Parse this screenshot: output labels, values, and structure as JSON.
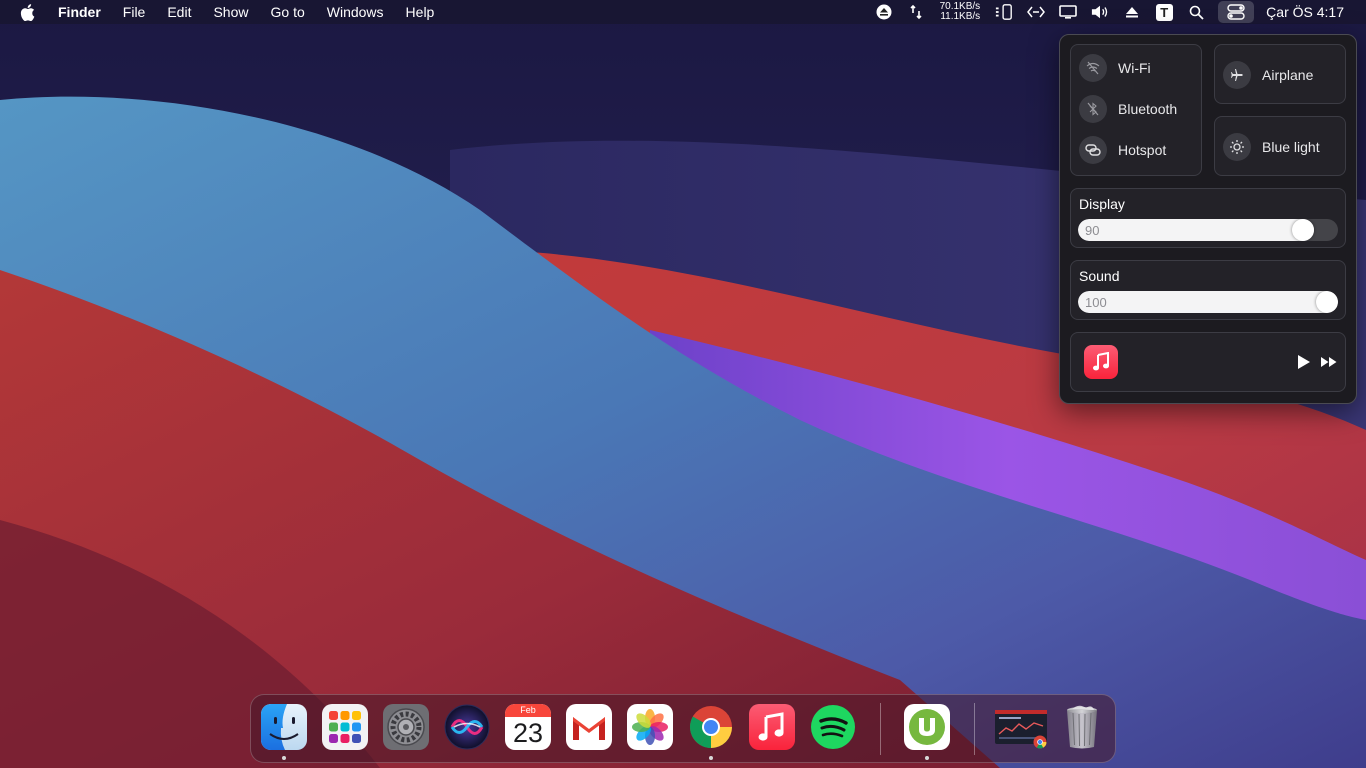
{
  "menubar": {
    "app_name": "Finder",
    "menus": [
      "File",
      "Edit",
      "Show",
      "Go to",
      "Windows",
      "Help"
    ],
    "net_up": "70.1KB/s",
    "net_down": "11.1KB/s",
    "clock": "Çar ÖS 4:17",
    "t_badge": "T"
  },
  "control_center": {
    "connectivity": [
      {
        "label": "Wi-Fi",
        "icon": "wifi-off-icon"
      },
      {
        "label": "Bluetooth",
        "icon": "bluetooth-off-icon"
      },
      {
        "label": "Hotspot",
        "icon": "hotspot-icon"
      }
    ],
    "airplane": {
      "label": "Airplane",
      "icon": "airplane-icon"
    },
    "blue_light": {
      "label": "Blue light",
      "icon": "sun-icon"
    },
    "display": {
      "title": "Display",
      "value": "90",
      "level": 0.9
    },
    "sound": {
      "title": "Sound",
      "value": "100",
      "level": 1.0
    },
    "media": {
      "app_icon": "music-icon",
      "play_icon": "play-icon",
      "next_icon": "fast-forward-icon"
    }
  },
  "dock": {
    "calendar": {
      "month": "Feb",
      "day": "23"
    },
    "apps": [
      "finder",
      "launchpad",
      "system-preferences",
      "siri",
      "calendar",
      "gmail",
      "photos",
      "chrome",
      "music",
      "spotify",
      "utorrent",
      "chrome-window",
      "trash"
    ]
  },
  "colors": {
    "accent_red": "#f83d55",
    "spotify_green": "#1ed760",
    "utorrent_green": "#76b83f",
    "panel_bg": "#1c1b20"
  }
}
